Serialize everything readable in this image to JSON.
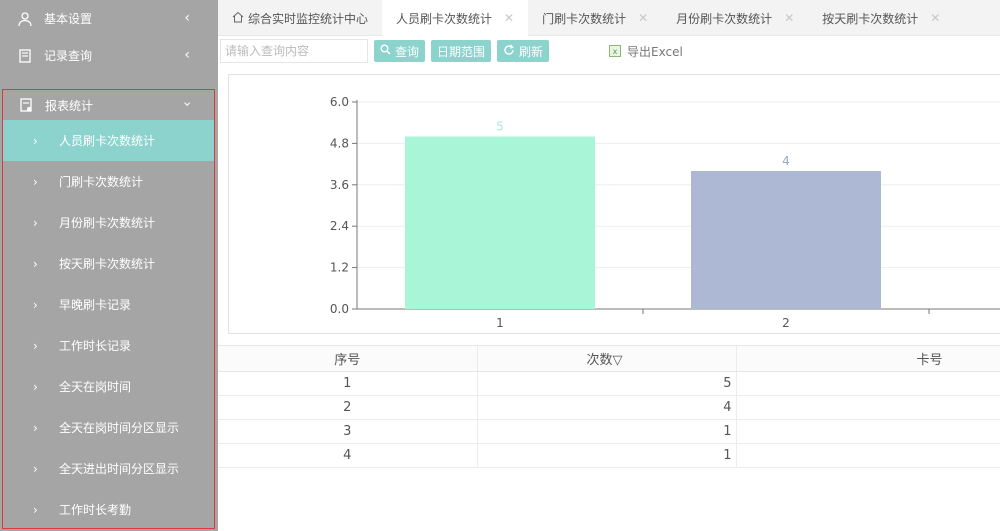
{
  "sidebar": {
    "items": [
      {
        "label": "基本设置",
        "icon": "user-icon"
      },
      {
        "label": "记录查询",
        "icon": "record-icon"
      }
    ],
    "report": {
      "label": "报表统计",
      "icon": "report-icon",
      "children": [
        {
          "label": "人员刷卡次数统计",
          "active": true
        },
        {
          "label": "门刷卡次数统计"
        },
        {
          "label": "月份刷卡次数统计"
        },
        {
          "label": "按天刷卡次数统计"
        },
        {
          "label": "早晚刷卡记录"
        },
        {
          "label": "工作时长记录"
        },
        {
          "label": "全天在岗时间"
        },
        {
          "label": "全天在岗时间分区显示"
        },
        {
          "label": "全天进出时间分区显示"
        },
        {
          "label": "工作时长考勤"
        }
      ]
    }
  },
  "tabs": [
    {
      "label": "综合实时监控统计中心",
      "home": true
    },
    {
      "label": "人员刷卡次数统计",
      "active": true
    },
    {
      "label": "门刷卡次数统计"
    },
    {
      "label": "月份刷卡次数统计"
    },
    {
      "label": "按天刷卡次数统计"
    }
  ],
  "toolbar": {
    "search_placeholder": "请输入查询内容",
    "query_label": "查询",
    "date_range_label": "日期范围",
    "refresh_label": "刷新",
    "export_label": "导出Excel"
  },
  "chart_data": {
    "type": "bar",
    "categories": [
      "1",
      "2"
    ],
    "values": [
      5,
      4
    ],
    "colors": [
      "#a8f5d7",
      "#adb9d4"
    ],
    "data_label_color": "#a8e8e0",
    "yticks": [
      "0.0",
      "1.2",
      "2.4",
      "3.6",
      "4.8",
      "6.0"
    ],
    "ylim": [
      0,
      6
    ],
    "grid": true
  },
  "table": {
    "headers": [
      "序号",
      "次数▽",
      "卡号"
    ],
    "rows": [
      [
        "1",
        "5",
        ""
      ],
      [
        "2",
        "4",
        ""
      ],
      [
        "3",
        "1",
        ""
      ],
      [
        "4",
        "1",
        ""
      ]
    ]
  }
}
